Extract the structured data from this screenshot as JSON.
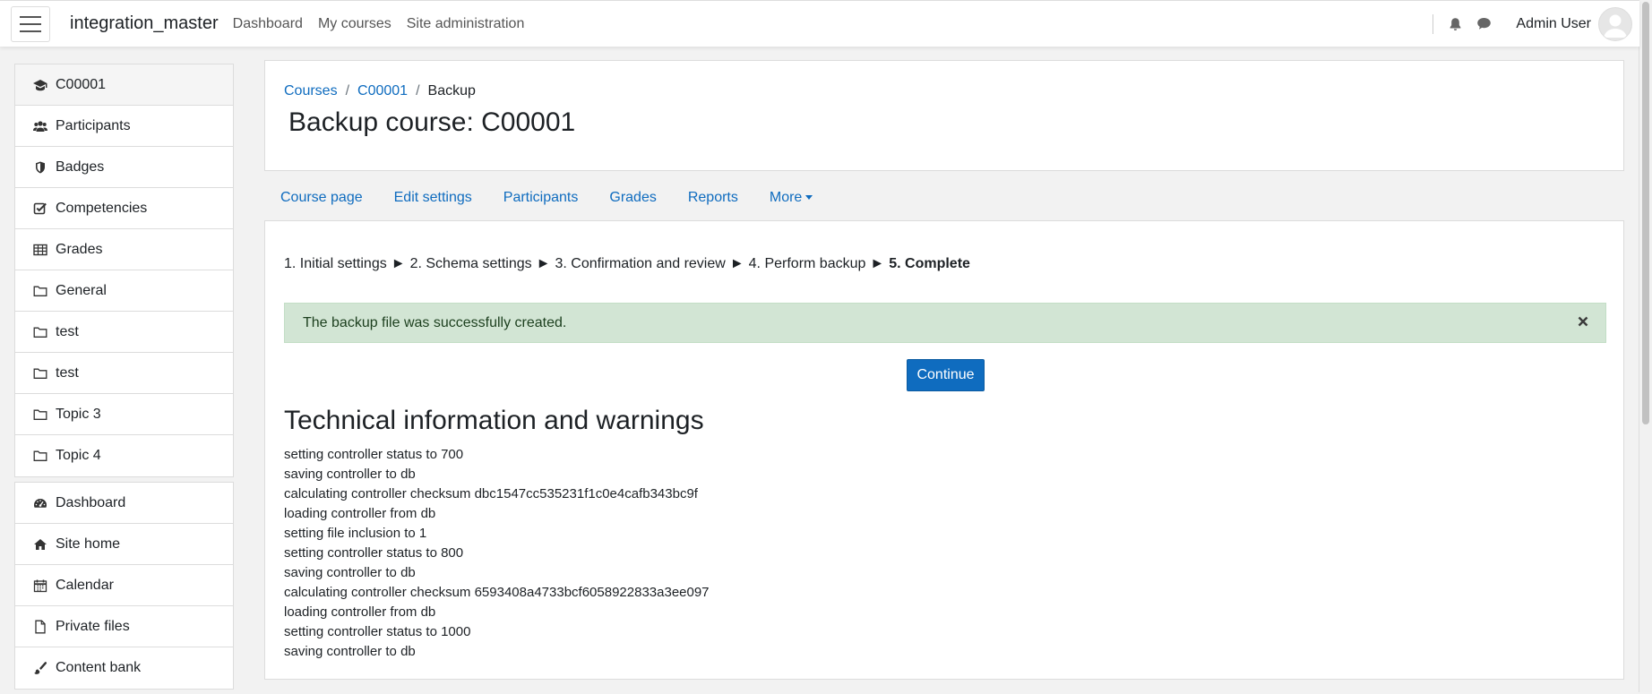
{
  "navbar": {
    "site_name": "integration_master",
    "links": [
      "Dashboard",
      "My courses",
      "Site administration"
    ],
    "user_name": "Admin User",
    "icons": [
      "menu-icon",
      "bell-icon",
      "chat-icon",
      "avatar-icon"
    ]
  },
  "drawer": {
    "course_items": [
      {
        "label": "C00001",
        "icon": "graduation-cap-icon"
      },
      {
        "label": "Participants",
        "icon": "users-icon"
      },
      {
        "label": "Badges",
        "icon": "shield-icon"
      },
      {
        "label": "Competencies",
        "icon": "check-square-icon"
      },
      {
        "label": "Grades",
        "icon": "table-icon"
      },
      {
        "label": "General",
        "icon": "folder-icon"
      },
      {
        "label": "test",
        "icon": "folder-icon"
      },
      {
        "label": "test",
        "icon": "folder-icon"
      },
      {
        "label": "Topic 3",
        "icon": "folder-icon"
      },
      {
        "label": "Topic 4",
        "icon": "folder-icon"
      }
    ],
    "site_items": [
      {
        "label": "Dashboard",
        "icon": "dashboard-icon"
      },
      {
        "label": "Site home",
        "icon": "home-icon"
      },
      {
        "label": "Calendar",
        "icon": "calendar-icon"
      },
      {
        "label": "Private files",
        "icon": "file-icon"
      },
      {
        "label": "Content bank",
        "icon": "paintbrush-icon"
      }
    ]
  },
  "header": {
    "breadcrumb": [
      "Courses",
      "C00001",
      "Backup"
    ],
    "title": "Backup course: C00001"
  },
  "secondary_nav": [
    "Course page",
    "Edit settings",
    "Participants",
    "Grades",
    "Reports",
    "More"
  ],
  "main": {
    "steps": [
      "1. Initial settings",
      "2. Schema settings",
      "3. Confirmation and review",
      "4. Perform backup",
      "5. Complete"
    ],
    "step_separator": "►",
    "alert": "The backup file was successfully created.",
    "continue_label": "Continue",
    "tech_title": "Technical information and warnings",
    "log": [
      "setting controller status to 700",
      "saving controller to db",
      "calculating controller checksum dbc1547cc535231f1c0e4cafb343bc9f",
      "loading controller from db",
      "setting file inclusion to 1",
      "setting controller status to 800",
      "saving controller to db",
      "calculating controller checksum 6593408a4733bcf6058922833a3ee097",
      "loading controller from db",
      "setting controller status to 1000",
      "saving controller to db"
    ]
  },
  "colors": {
    "link": "#0f6cbf",
    "primary_button": "#0f6cbf",
    "success_alert_bg": "#d2e5d4",
    "page_bg": "#f2f2f2"
  }
}
